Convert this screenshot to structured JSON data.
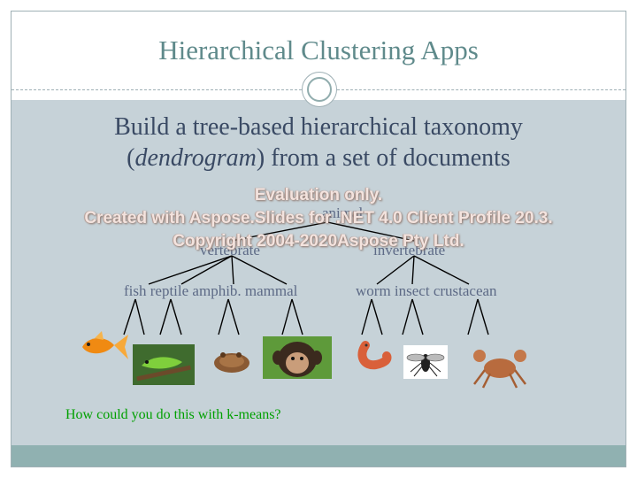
{
  "slide": {
    "title": "Hierarchical Clustering Apps",
    "subtitle_part1": "Build a tree-based hierarchical taxonomy",
    "subtitle_open": "(",
    "subtitle_italic": "dendrogram",
    "subtitle_part2": ") from a set of documents",
    "question": "How could you do this with k-means?"
  },
  "tree": {
    "root": "animal",
    "level1": [
      "vertebrate",
      "invertebrate"
    ],
    "vertebrates": "fish reptile amphib. mammal",
    "invertebrates": "worm insect crustacean"
  },
  "images": [
    "goldfish-icon",
    "lizard-icon",
    "frog-icon",
    "monkey-icon",
    "worm-icon",
    "fly-icon",
    "crab-icon"
  ],
  "watermark": {
    "line1": "Evaluation only.",
    "line2": "Created with Aspose.Slides for .NET 4.0 Client Profile 20.3.",
    "line3": "Copyright 2004-2020Aspose Pty Ltd."
  },
  "colors": {
    "title": "#5f8a8b",
    "body_bg": "#c6d2d8",
    "footer": "#90b1b1",
    "question": "#00a000"
  }
}
